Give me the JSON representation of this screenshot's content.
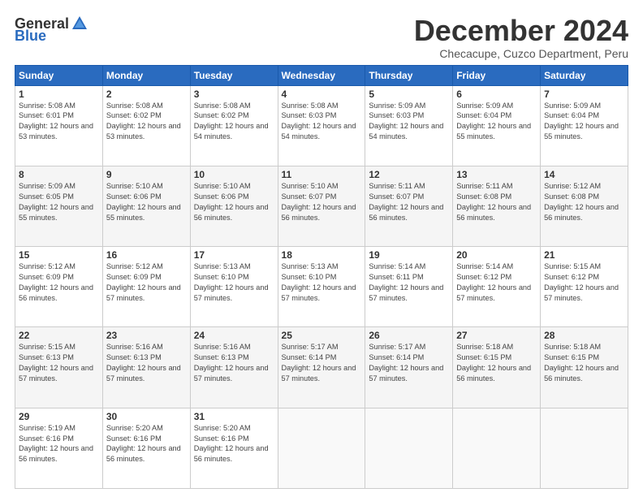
{
  "logo": {
    "general": "General",
    "blue": "Blue"
  },
  "title": {
    "month": "December 2024",
    "location": "Checacupe, Cuzco Department, Peru"
  },
  "headers": [
    "Sunday",
    "Monday",
    "Tuesday",
    "Wednesday",
    "Thursday",
    "Friday",
    "Saturday"
  ],
  "weeks": [
    [
      {
        "day": "1",
        "sunrise": "5:08 AM",
        "sunset": "6:01 PM",
        "daylight": "12 hours and 53 minutes."
      },
      {
        "day": "2",
        "sunrise": "5:08 AM",
        "sunset": "6:02 PM",
        "daylight": "12 hours and 53 minutes."
      },
      {
        "day": "3",
        "sunrise": "5:08 AM",
        "sunset": "6:02 PM",
        "daylight": "12 hours and 54 minutes."
      },
      {
        "day": "4",
        "sunrise": "5:08 AM",
        "sunset": "6:03 PM",
        "daylight": "12 hours and 54 minutes."
      },
      {
        "day": "5",
        "sunrise": "5:09 AM",
        "sunset": "6:03 PM",
        "daylight": "12 hours and 54 minutes."
      },
      {
        "day": "6",
        "sunrise": "5:09 AM",
        "sunset": "6:04 PM",
        "daylight": "12 hours and 55 minutes."
      },
      {
        "day": "7",
        "sunrise": "5:09 AM",
        "sunset": "6:04 PM",
        "daylight": "12 hours and 55 minutes."
      }
    ],
    [
      {
        "day": "8",
        "sunrise": "5:09 AM",
        "sunset": "6:05 PM",
        "daylight": "12 hours and 55 minutes."
      },
      {
        "day": "9",
        "sunrise": "5:10 AM",
        "sunset": "6:06 PM",
        "daylight": "12 hours and 55 minutes."
      },
      {
        "day": "10",
        "sunrise": "5:10 AM",
        "sunset": "6:06 PM",
        "daylight": "12 hours and 56 minutes."
      },
      {
        "day": "11",
        "sunrise": "5:10 AM",
        "sunset": "6:07 PM",
        "daylight": "12 hours and 56 minutes."
      },
      {
        "day": "12",
        "sunrise": "5:11 AM",
        "sunset": "6:07 PM",
        "daylight": "12 hours and 56 minutes."
      },
      {
        "day": "13",
        "sunrise": "5:11 AM",
        "sunset": "6:08 PM",
        "daylight": "12 hours and 56 minutes."
      },
      {
        "day": "14",
        "sunrise": "5:12 AM",
        "sunset": "6:08 PM",
        "daylight": "12 hours and 56 minutes."
      }
    ],
    [
      {
        "day": "15",
        "sunrise": "5:12 AM",
        "sunset": "6:09 PM",
        "daylight": "12 hours and 56 minutes."
      },
      {
        "day": "16",
        "sunrise": "5:12 AM",
        "sunset": "6:09 PM",
        "daylight": "12 hours and 57 minutes."
      },
      {
        "day": "17",
        "sunrise": "5:13 AM",
        "sunset": "6:10 PM",
        "daylight": "12 hours and 57 minutes."
      },
      {
        "day": "18",
        "sunrise": "5:13 AM",
        "sunset": "6:10 PM",
        "daylight": "12 hours and 57 minutes."
      },
      {
        "day": "19",
        "sunrise": "5:14 AM",
        "sunset": "6:11 PM",
        "daylight": "12 hours and 57 minutes."
      },
      {
        "day": "20",
        "sunrise": "5:14 AM",
        "sunset": "6:12 PM",
        "daylight": "12 hours and 57 minutes."
      },
      {
        "day": "21",
        "sunrise": "5:15 AM",
        "sunset": "6:12 PM",
        "daylight": "12 hours and 57 minutes."
      }
    ],
    [
      {
        "day": "22",
        "sunrise": "5:15 AM",
        "sunset": "6:13 PM",
        "daylight": "12 hours and 57 minutes."
      },
      {
        "day": "23",
        "sunrise": "5:16 AM",
        "sunset": "6:13 PM",
        "daylight": "12 hours and 57 minutes."
      },
      {
        "day": "24",
        "sunrise": "5:16 AM",
        "sunset": "6:13 PM",
        "daylight": "12 hours and 57 minutes."
      },
      {
        "day": "25",
        "sunrise": "5:17 AM",
        "sunset": "6:14 PM",
        "daylight": "12 hours and 57 minutes."
      },
      {
        "day": "26",
        "sunrise": "5:17 AM",
        "sunset": "6:14 PM",
        "daylight": "12 hours and 57 minutes."
      },
      {
        "day": "27",
        "sunrise": "5:18 AM",
        "sunset": "6:15 PM",
        "daylight": "12 hours and 56 minutes."
      },
      {
        "day": "28",
        "sunrise": "5:18 AM",
        "sunset": "6:15 PM",
        "daylight": "12 hours and 56 minutes."
      }
    ],
    [
      {
        "day": "29",
        "sunrise": "5:19 AM",
        "sunset": "6:16 PM",
        "daylight": "12 hours and 56 minutes."
      },
      {
        "day": "30",
        "sunrise": "5:20 AM",
        "sunset": "6:16 PM",
        "daylight": "12 hours and 56 minutes."
      },
      {
        "day": "31",
        "sunrise": "5:20 AM",
        "sunset": "6:16 PM",
        "daylight": "12 hours and 56 minutes."
      },
      null,
      null,
      null,
      null
    ]
  ],
  "labels": {
    "sunrise": "Sunrise:",
    "sunset": "Sunset:",
    "daylight": "Daylight:"
  }
}
